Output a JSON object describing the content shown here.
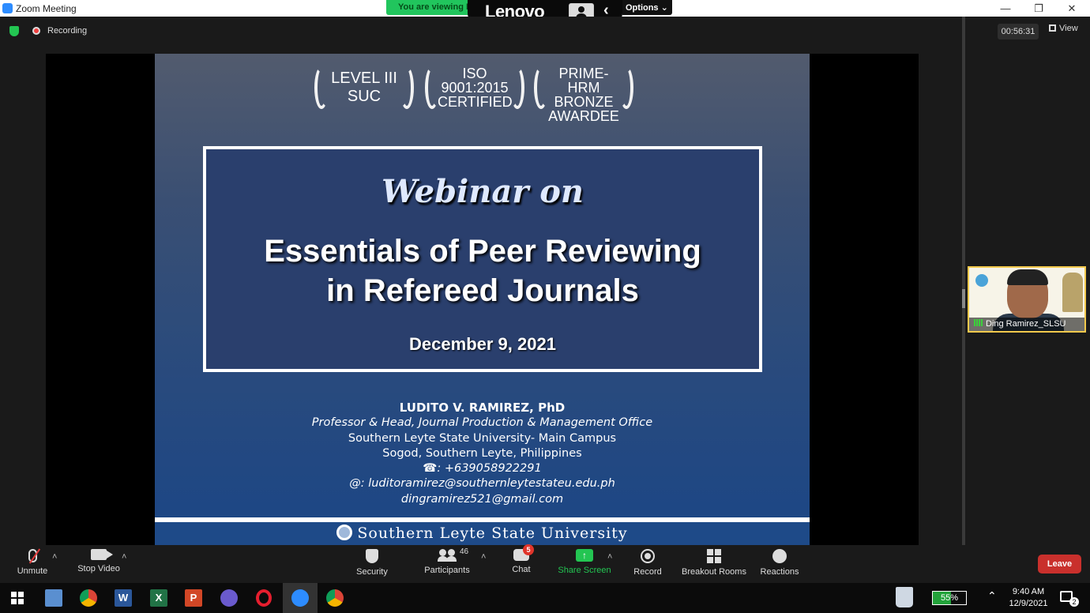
{
  "window": {
    "title": "Zoom Meeting"
  },
  "share_banner": {
    "text": "You are viewing D",
    "options_label": "Options"
  },
  "camera_bar": {
    "brand": "Lenovo"
  },
  "status": {
    "recording_label": "Recording",
    "timer": "00:56:31",
    "view_label": "View"
  },
  "slide": {
    "awards": [
      {
        "line1": "LEVEL III",
        "line2": "SUC",
        "line3": ""
      },
      {
        "line1": "ISO",
        "line2": "9001:2015",
        "line3": "CERTIFIED"
      },
      {
        "line1": "PRIME-HRM",
        "line2": "BRONZE",
        "line3": "AWARDEE"
      }
    ],
    "webinar_label": "Webinar on",
    "title_line1": "Essentials of Peer Reviewing",
    "title_line2": "in Refereed Journals",
    "date": "December 9, 2021",
    "presenter_name": "LUDITO V. RAMIREZ, PhD",
    "presenter_role": "Professor & Head, Journal Production & Management Office",
    "campus": "Southern Leyte State University- Main Campus",
    "location": "Sogod, Southern Leyte, Philippines",
    "phone": "☎: +639058922291",
    "email1": "@: luditoramirez@southernleytestateu.edu.ph",
    "email2": "dingramirez521@gmail.com",
    "university": "Southern Leyte State University"
  },
  "participant_thumb": {
    "name": "Ding Ramirez_SLSU"
  },
  "toolbar": {
    "unmute": "Unmute",
    "stop_video": "Stop Video",
    "security": "Security",
    "participants": "Participants",
    "participants_count": "46",
    "chat": "Chat",
    "chat_badge": "5",
    "share_screen": "Share Screen",
    "record": "Record",
    "breakout_rooms": "Breakout Rooms",
    "reactions": "Reactions",
    "leave": "Leave"
  },
  "taskbar": {
    "battery": "55%",
    "time": "9:40 AM",
    "date": "12/9/2021",
    "notifications": "2"
  },
  "colors": {
    "accent_green": "#23c552",
    "leave_red": "#c9302c",
    "slide_blue": "#1b4686"
  }
}
